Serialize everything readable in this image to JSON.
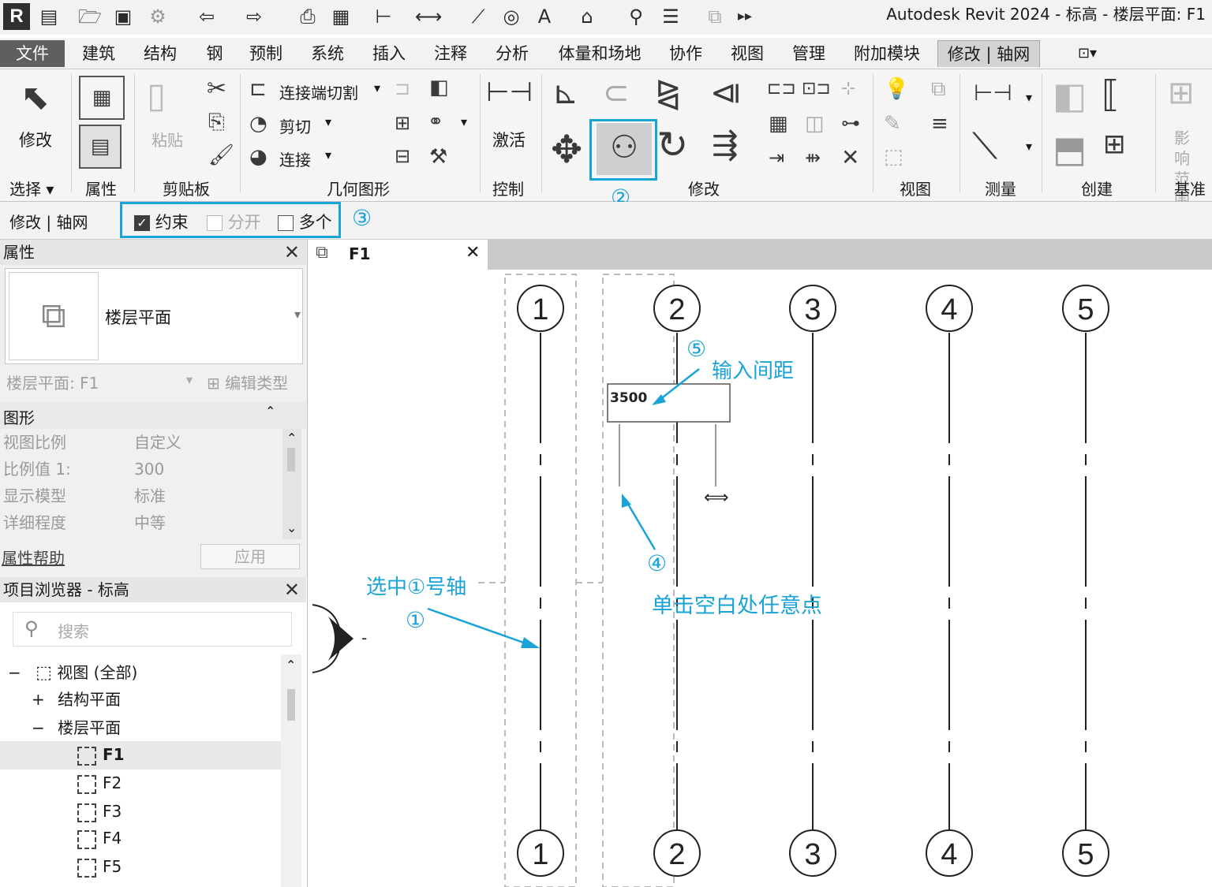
{
  "title_bar": {
    "app_logo": "R",
    "window_title": "Autodesk Revit 2024 - 标高 - 楼层平面: F1"
  },
  "menu_tabs": [
    "文件",
    "建筑",
    "结构",
    "钢",
    "预制",
    "系统",
    "插入",
    "注释",
    "分析",
    "体量和场地",
    "协作",
    "视图",
    "管理",
    "附加模块",
    "修改 | 轴网"
  ],
  "ribbon": {
    "select_panel": {
      "modify_label": "修改",
      "label": "选择 ▾"
    },
    "properties_panel": {
      "label": "属性"
    },
    "clipboard_panel": {
      "paste_label": "粘贴",
      "label": "剪贴板"
    },
    "geometry_panel": {
      "cope_label": "连接端切割",
      "cut_label": "剪切",
      "join_label": "连接",
      "label": "几何图形"
    },
    "controls_panel": {
      "activate_label": "激活",
      "label": "控制"
    },
    "modify_panel": {
      "label": "修改"
    },
    "view_panel": {
      "label": "视图"
    },
    "measure_panel": {
      "label": "测量"
    },
    "create_panel": {
      "label": "创建"
    },
    "datum_panel": {
      "scope_label": "影响范围",
      "label": "基准"
    }
  },
  "options_bar": {
    "context": "修改 | 轴网",
    "constrain": "约束",
    "disjoin": "分开",
    "multiple": "多个"
  },
  "properties": {
    "title": "属性",
    "type_name": "楼层平面",
    "instance_selector": "楼层平面: F1",
    "edit_type": "编辑类型",
    "group": "图形",
    "rows": [
      {
        "name": "视图比例",
        "value": "自定义"
      },
      {
        "name": "比例值 1:",
        "value": "300"
      },
      {
        "name": "显示模型",
        "value": "标准"
      },
      {
        "name": "详细程度",
        "value": "中等"
      }
    ],
    "help_link": "属性帮助",
    "apply_button": "应用"
  },
  "project_browser": {
    "title": "项目浏览器 - 标高",
    "search_placeholder": "搜索",
    "tree": {
      "root": "视图 (全部)",
      "structural_plans": "结构平面",
      "floor_plans": "楼层平面",
      "levels": [
        "F1",
        "F2",
        "F3",
        "F4",
        "F5"
      ]
    }
  },
  "view_tab": {
    "name": "F1"
  },
  "grid_bubbles": [
    "1",
    "2",
    "3",
    "4",
    "5"
  ],
  "dimension_input": "3500",
  "annotations": {
    "step1_marker": "①",
    "step1_text": "选中①号轴",
    "step2_marker": "②",
    "step3_marker": "③",
    "step4_marker": "④",
    "step4_text": "单击空白处任意点",
    "step5_marker": "⑤",
    "step5_text": "输入间距",
    "color": "#1aa3d6"
  }
}
